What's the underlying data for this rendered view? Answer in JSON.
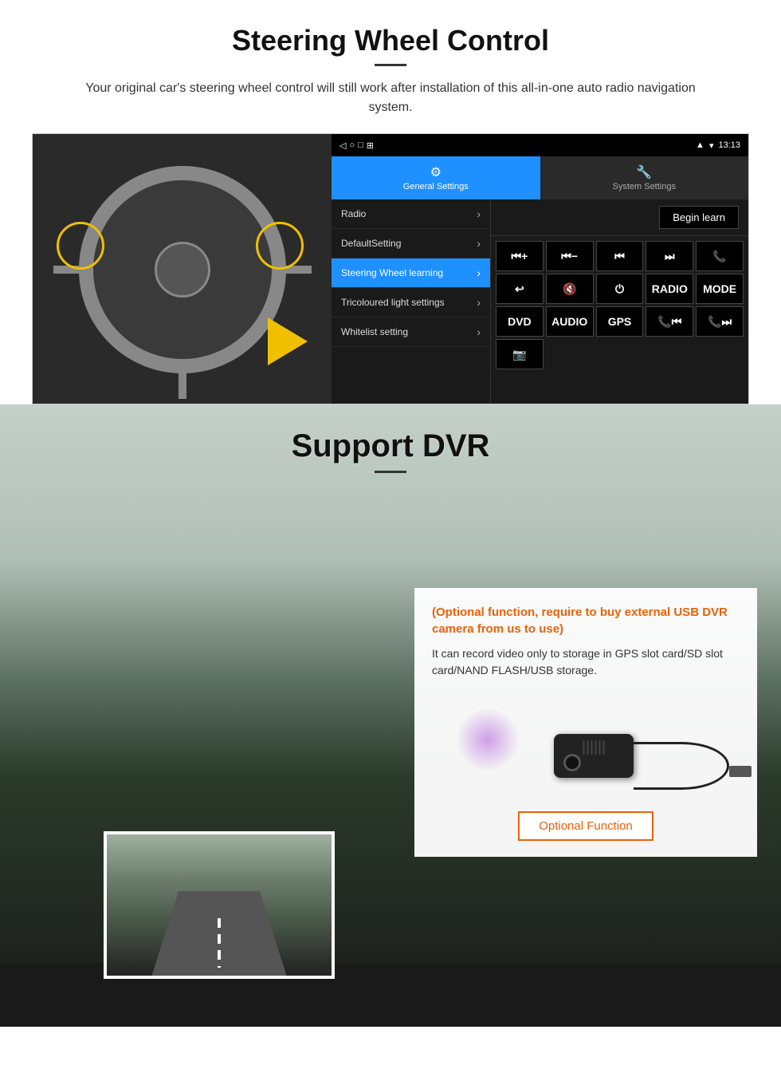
{
  "steering": {
    "title": "Steering Wheel Control",
    "subtitle": "Your original car's steering wheel control will still work after installation of this all-in-one auto radio navigation system.",
    "status_bar": {
      "time": "13:13",
      "icons": [
        "signal",
        "wifi",
        "battery"
      ]
    },
    "tabs": [
      {
        "label": "General Settings",
        "icon": "⚙",
        "active": true
      },
      {
        "label": "System Settings",
        "icon": "🔧",
        "active": false
      }
    ],
    "menu_items": [
      {
        "label": "Radio",
        "selected": false
      },
      {
        "label": "DefaultSetting",
        "selected": false
      },
      {
        "label": "Steering Wheel learning",
        "selected": true
      },
      {
        "label": "Tricoloured light settings",
        "selected": false
      },
      {
        "label": "Whitelist setting",
        "selected": false
      }
    ],
    "begin_learn": "Begin learn",
    "control_buttons": [
      {
        "symbol": "⏮+",
        "label": "vol_up_prev"
      },
      {
        "symbol": "⏮-",
        "label": "vol_down_prev"
      },
      {
        "symbol": "⏮",
        "label": "prev_track"
      },
      {
        "symbol": "⏭",
        "label": "next_track"
      },
      {
        "symbol": "📞",
        "label": "phone"
      },
      {
        "symbol": "↩",
        "label": "hang_up"
      },
      {
        "symbol": "🔇",
        "label": "mute"
      },
      {
        "symbol": "⏻",
        "label": "power"
      },
      {
        "symbol": "RADIO",
        "label": "radio"
      },
      {
        "symbol": "MODE",
        "label": "mode"
      },
      {
        "symbol": "DVD",
        "label": "dvd"
      },
      {
        "symbol": "AUDIO",
        "label": "audio"
      },
      {
        "symbol": "GPS",
        "label": "gps"
      },
      {
        "symbol": "📞⏮",
        "label": "call_prev"
      },
      {
        "symbol": "📞⏭",
        "label": "call_next"
      },
      {
        "symbol": "📷",
        "label": "camera"
      }
    ]
  },
  "dvr": {
    "title": "Support DVR",
    "optional_text": "(Optional function, require to buy external USB DVR camera from us to use)",
    "description": "It can record video only to storage in GPS slot card/SD slot card/NAND FLASH/USB storage.",
    "optional_function_label": "Optional Function"
  }
}
